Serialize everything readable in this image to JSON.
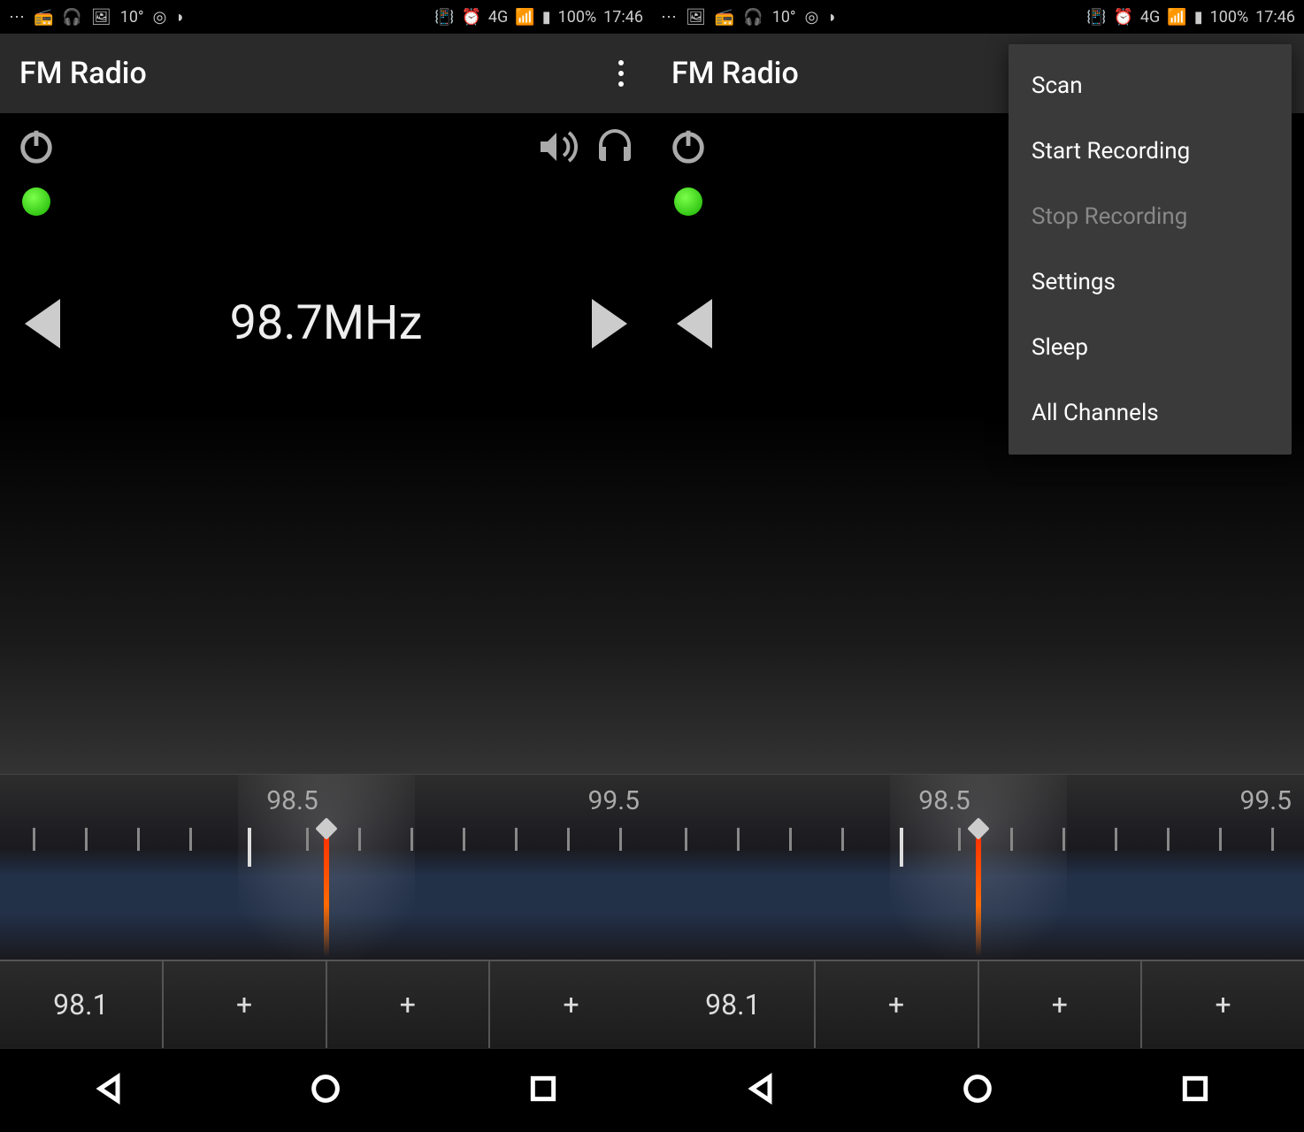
{
  "status": {
    "temp": "10°",
    "battery": "100%",
    "time": "17:46",
    "signal_label": "4G"
  },
  "app": {
    "title": "FM Radio"
  },
  "tuner": {
    "frequency": "98.7MHz",
    "frequency_partial": "98.",
    "dial_center_label": "98.5",
    "dial_right_label": "99.5"
  },
  "presets": [
    "98.1",
    "+",
    "+",
    "+"
  ],
  "menu": {
    "items": [
      {
        "label": "Scan",
        "disabled": false
      },
      {
        "label": "Start Recording",
        "disabled": false
      },
      {
        "label": "Stop Recording",
        "disabled": true
      },
      {
        "label": "Settings",
        "disabled": false
      },
      {
        "label": "Sleep",
        "disabled": false
      },
      {
        "label": "All Channels",
        "disabled": false
      }
    ]
  },
  "colors": {
    "needle": "#ff3a00",
    "record_indicator": "#22cc22"
  }
}
